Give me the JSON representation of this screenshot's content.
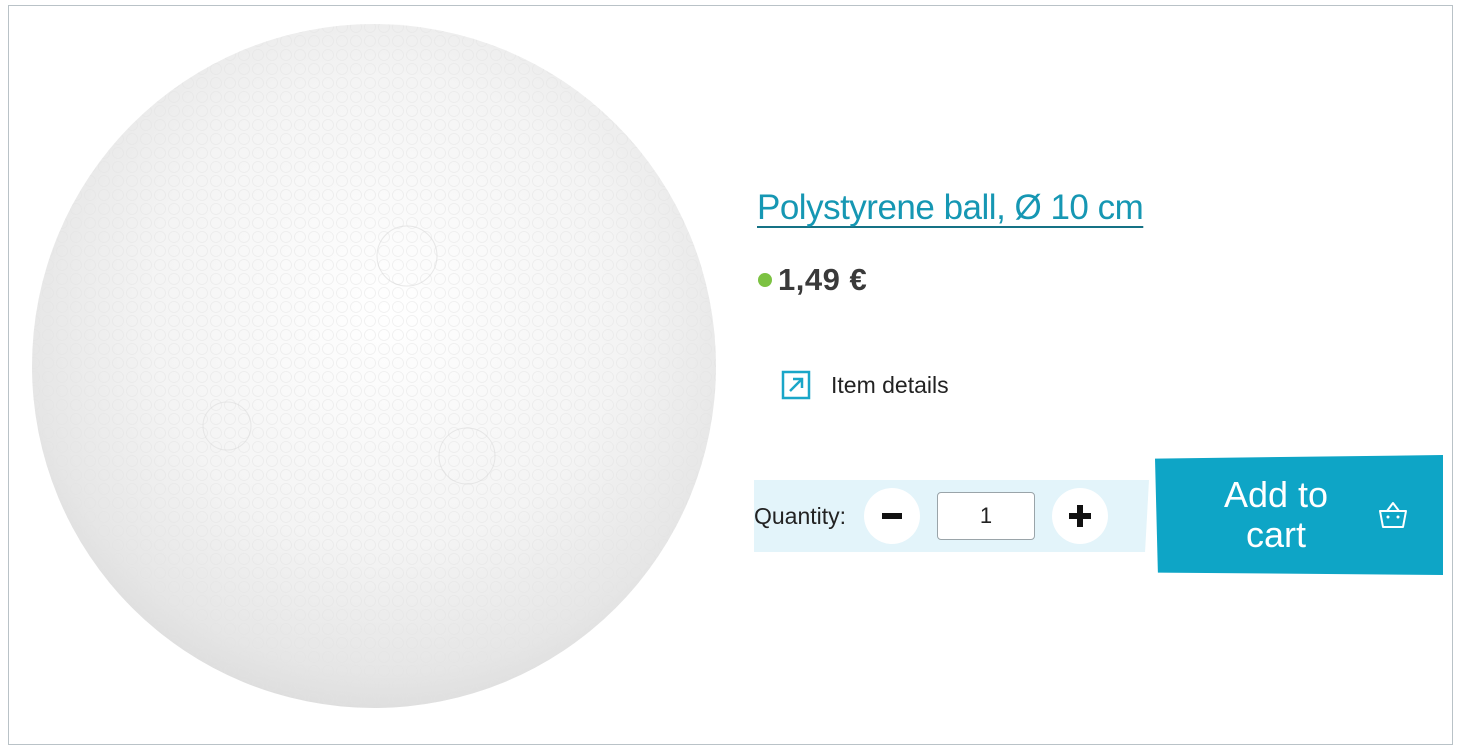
{
  "product": {
    "title": "Polystyrene ball, Ø 10 cm",
    "price": "1,49 €",
    "image_alt": "white polystyrene ball"
  },
  "details": {
    "label": "Item details",
    "icon": "external-arrow-icon"
  },
  "quantity": {
    "label": "Quantity:",
    "value": "1",
    "decrement_icon": "minus-icon",
    "increment_icon": "plus-icon"
  },
  "cart": {
    "label": "Add to cart",
    "icon": "basket-icon"
  },
  "colors": {
    "accent": "#0ea5c6",
    "link": "#1697b3",
    "in_stock": "#7cc242",
    "qty_background": "#e3f4fa"
  }
}
